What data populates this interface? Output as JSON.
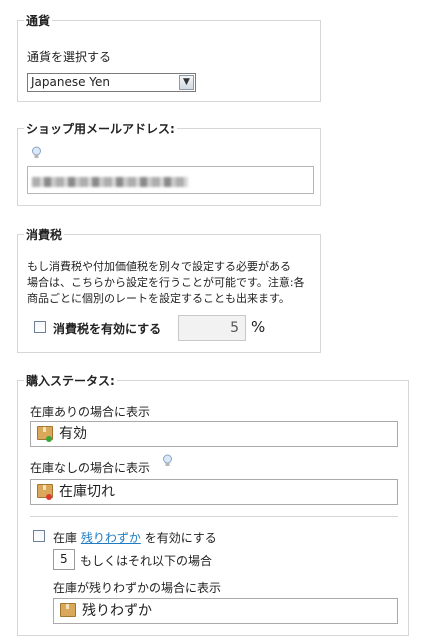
{
  "currency": {
    "legend": "通貨",
    "label": "通貨を選択する",
    "selected": "Japanese Yen"
  },
  "shop_email": {
    "legend": "ショップ用メールアドレス:",
    "value": ""
  },
  "consumption_tax": {
    "legend": "消費税",
    "description_lines": [
      "もし消費税や付加価値税を別々で設定する必要がある",
      "場合は、こちらから設定を行うことが可能です。注意:各",
      "商品ごとに個別のレートを設定することも出来ます。"
    ],
    "enable_label": "消費税を有効にする",
    "rate": "5",
    "unit": "%"
  },
  "purchase_status": {
    "legend": "購入ステータス:",
    "in_stock_label": "在庫ありの場合に表示",
    "in_stock_value": "有効",
    "out_of_stock_label": "在庫なしの場合に表示",
    "out_of_stock_value": "在庫切れ",
    "low_stock_prefix": "在庫",
    "low_stock_link": "残りわずか",
    "low_stock_suffix": "を有効にする",
    "threshold": "5",
    "threshold_label": "もしくはそれ以下の場合",
    "low_stock_display_label": "在庫が残りわずかの場合に表示",
    "low_stock_value": "残りわずか"
  },
  "colors": {
    "link": "#1f7cc2",
    "in_stock_badge": "#3aa33a",
    "out_of_stock_badge": "#d93a2b"
  },
  "icons": [
    "chevron-down-icon",
    "lightbulb-icon",
    "package-icon",
    "checkbox-icon"
  ]
}
